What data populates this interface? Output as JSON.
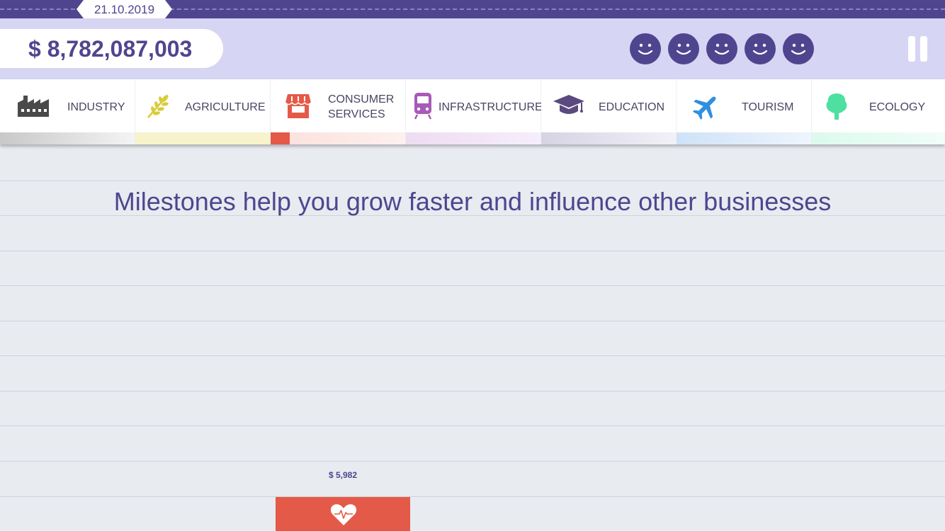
{
  "top_bar": {
    "date": "21.10.2019"
  },
  "header": {
    "balance": "$ 8,782,087,003",
    "smileys": [
      "smiley-face-icon",
      "smiley-face-icon",
      "smiley-face-icon",
      "smiley-face-icon",
      "smiley-face-icon"
    ],
    "pause_icon": "pause-icon"
  },
  "categories": [
    {
      "label": "INDUSTRY",
      "icon": "factory-icon",
      "color": "#4a4a4a",
      "progress": 0.0
    },
    {
      "label": "AGRICULTURE",
      "icon": "wheat-icon",
      "color": "#d8cc3a",
      "progress": 0.0
    },
    {
      "label": "CONSUMER SERVICES",
      "icon": "storefront-icon",
      "color": "#e45a48",
      "progress": 0.14
    },
    {
      "label": "INFRASTRUCTURE",
      "icon": "train-icon",
      "color": "#a85ab8",
      "progress": 0.0
    },
    {
      "label": "EDUCATION",
      "icon": "graduation-cap-icon",
      "color": "#5a4a80",
      "progress": 0.0
    },
    {
      "label": "TOURISM",
      "icon": "airplane-icon",
      "color": "#2f8fe0",
      "progress": 0.0
    },
    {
      "label": "ECOLOGY",
      "icon": "tree-icon",
      "color": "#4ee0a0",
      "progress": 0.0
    }
  ],
  "main": {
    "headline": "Milestones help you grow faster and influence other businesses",
    "milestone_price": "$ 5,982",
    "milestone_icon": "heartbeat-icon"
  },
  "colors": {
    "brand": "#4f458f",
    "header_bg": "#d7d5f4",
    "page_bg": "#e8ebf0",
    "card": "#e45a48"
  }
}
